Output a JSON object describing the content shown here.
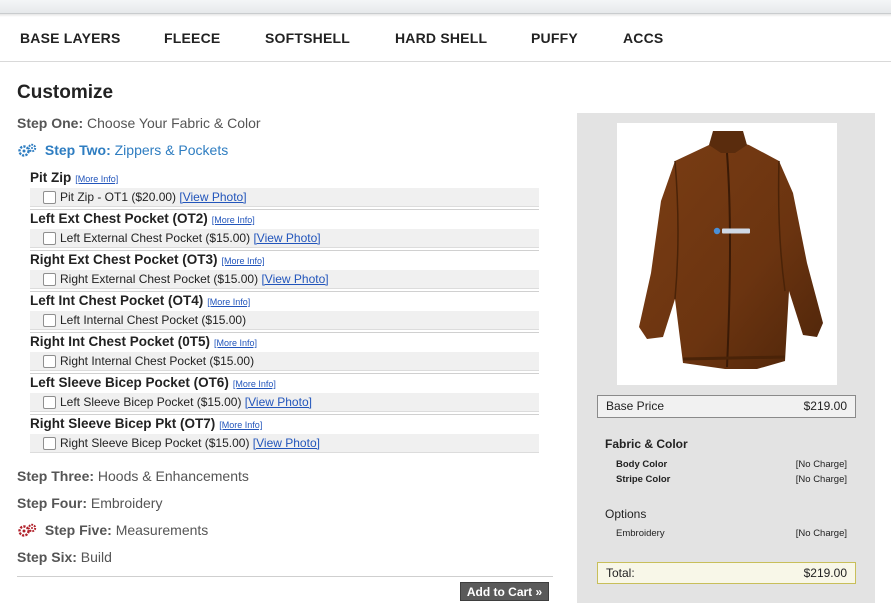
{
  "nav": {
    "items": [
      "BASE LAYERS",
      "FLEECE",
      "SOFTSHELL",
      "HARD SHELL",
      "PUFFY",
      "ACCS"
    ]
  },
  "page": {
    "title": "Customize"
  },
  "steps": [
    {
      "label": "Step One:",
      "text": "Choose Your Fabric & Color"
    },
    {
      "label": "Step Two:",
      "text": "Zippers & Pockets"
    },
    {
      "label": "Step Three:",
      "text": "Hoods & Enhancements"
    },
    {
      "label": "Step Four:",
      "text": "Embroidery"
    },
    {
      "label": "Step Five:",
      "text": "Measurements"
    },
    {
      "label": "Step Six:",
      "text": "Build"
    }
  ],
  "more_info_label": "[More Info]",
  "view_photo_label": "[View Photo]",
  "options": [
    {
      "title": "Pit Zip",
      "item": "Pit Zip - OT1 ($20.00)"
    },
    {
      "title": "Left Ext Chest Pocket (OT2)",
      "item": "Left External Chest Pocket ($15.00)"
    },
    {
      "title": "Right Ext Chest Pocket (OT3)",
      "item": "Right External Chest Pocket ($15.00)"
    },
    {
      "title": "Left Int Chest Pocket (OT4)",
      "item": "Left Internal Chest Pocket ($15.00)"
    },
    {
      "title": "Right Int Chest Pocket (0T5)",
      "item": "Right Internal Chest Pocket ($15.00)"
    },
    {
      "title": "Left Sleeve Bicep Pocket (OT6)",
      "item": "Left Sleeve Bicep Pocket ($15.00)"
    },
    {
      "title": "Right Sleeve Bicep Pkt (OT7)",
      "item": "Right Sleeve Bicep Pocket ($15.00)"
    }
  ],
  "cart": {
    "label": "Add to Cart »"
  },
  "summary": {
    "base_price_label": "Base Price",
    "base_price": "$219.00",
    "fabric_title": "Fabric & Color",
    "body_color_label": "Body Color",
    "body_color_value": "[No Charge]",
    "stripe_color_label": "Stripe Color",
    "stripe_color_value": "[No Charge]",
    "options_title": "Options",
    "embroidery_label": "Embroidery",
    "embroidery_value": "[No Charge]",
    "total_label": "Total:",
    "total_value": "$219.00"
  },
  "colors": {
    "accent": "#2e7dc1",
    "step_five_icon": "#b0202a",
    "jacket": "#6b3410"
  },
  "icons": {
    "step_two": "blue-gear-icon",
    "step_five": "red-gear-icon",
    "logo": "beyond-logo"
  }
}
